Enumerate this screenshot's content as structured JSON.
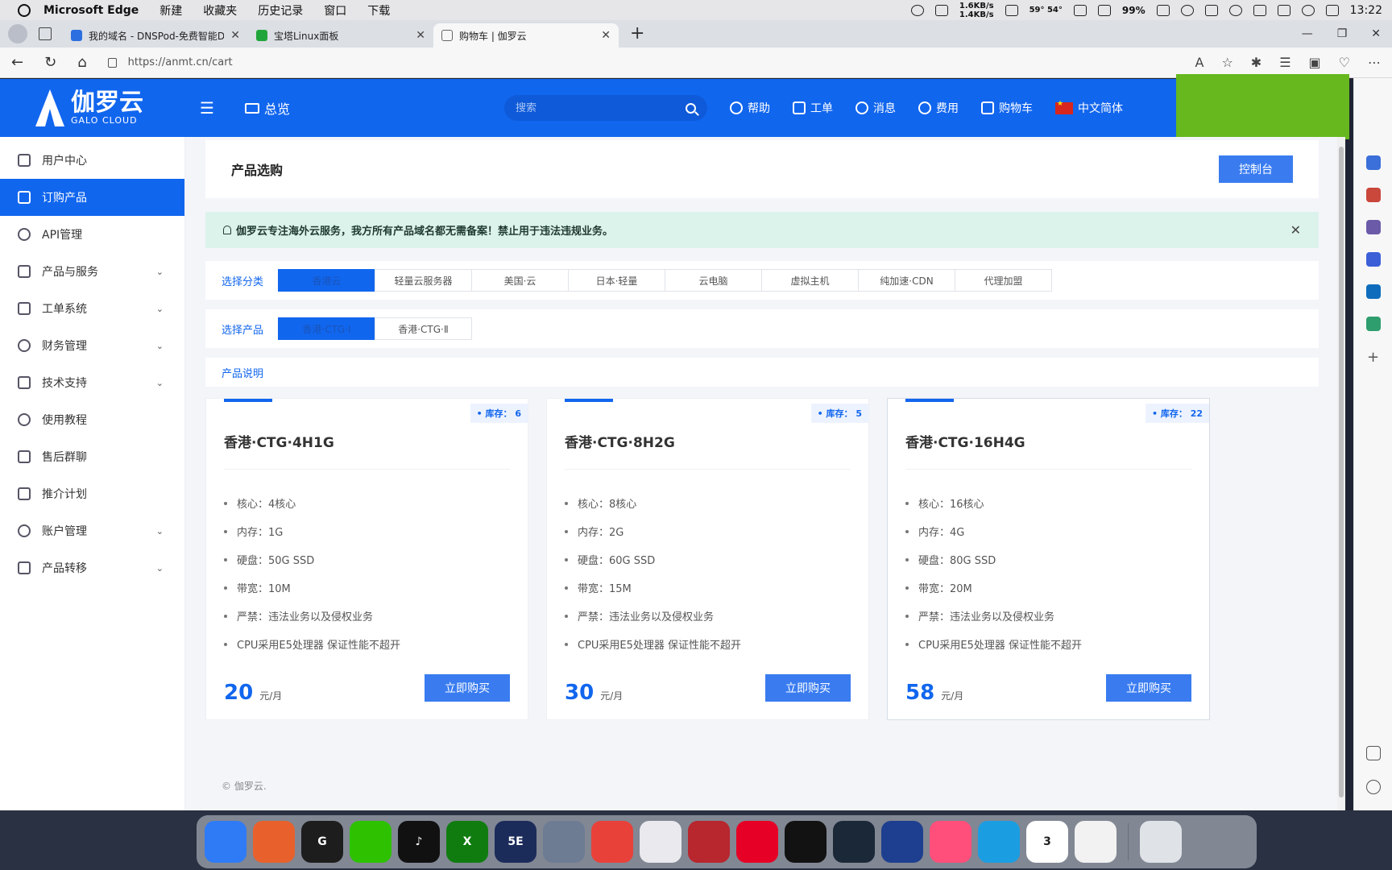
{
  "menubar": {
    "app_name": "Microsoft Edge",
    "menus": [
      "新建",
      "收藏夹",
      "历史记录",
      "窗口",
      "下载"
    ],
    "net_up": "1.6KB/s",
    "net_down": "1.4KB/s",
    "temps": "59° 54°",
    "battery": "99%",
    "time": "13:22"
  },
  "browser": {
    "tabs": [
      {
        "title": "我的域名 - DNSPod-免费智能DN",
        "color": "#2b6fe0"
      },
      {
        "title": "宝塔Linux面板",
        "color": "#20a53a"
      },
      {
        "title": "购物车 | 伽罗云",
        "color": "#bbbbbb"
      }
    ],
    "url": "https://anmt.cn/cart"
  },
  "header": {
    "logo_cn": "伽罗云",
    "logo_en": "GALO CLOUD",
    "overview": "总览",
    "search_placeholder": "搜索",
    "links": [
      {
        "icon": "help-icon",
        "label": "帮助"
      },
      {
        "icon": "ticket-icon",
        "label": "工单"
      },
      {
        "icon": "bell-icon",
        "label": "消息"
      },
      {
        "icon": "coin-icon",
        "label": "费用"
      },
      {
        "icon": "cart-icon",
        "label": "购物车"
      }
    ],
    "language": "中文简体"
  },
  "sidebar": {
    "items": [
      {
        "label": "用户中心",
        "icon": "home-icon",
        "expandable": false
      },
      {
        "label": "订购产品",
        "icon": "cart-icon",
        "expandable": false
      },
      {
        "label": "API管理",
        "icon": "fingerprint-icon",
        "expandable": false
      },
      {
        "label": "产品与服务",
        "icon": "grid-icon",
        "expandable": true
      },
      {
        "label": "工单系统",
        "icon": "chat-icon",
        "expandable": true
      },
      {
        "label": "财务管理",
        "icon": "dollar-icon",
        "expandable": true
      },
      {
        "label": "技术支持",
        "icon": "document-icon",
        "expandable": true
      },
      {
        "label": "使用教程",
        "icon": "search-icon",
        "expandable": false
      },
      {
        "label": "售后群聊",
        "icon": "phone-icon",
        "expandable": false
      },
      {
        "label": "推介计划",
        "icon": "send-icon",
        "expandable": false
      },
      {
        "label": "账户管理",
        "icon": "user-icon",
        "expandable": true
      },
      {
        "label": "产品转移",
        "icon": "grid-icon",
        "expandable": true
      }
    ]
  },
  "page": {
    "title": "产品选购",
    "console_button": "控制台",
    "notice": "伽罗云专注海外云服务，我方所有产品域名都无需备案！禁止用于违法违规业务。",
    "category_label": "选择分类",
    "categories": [
      "香港云",
      "轻量云服务器",
      "美国·云",
      "日本·轻量",
      "云电脑",
      "虚拟主机",
      "纯加速·CDN",
      "代理加盟"
    ],
    "product_label": "选择产品",
    "products": [
      "香港·CTG·I",
      "香港·CTG·Ⅱ"
    ],
    "description_label": "产品说明",
    "stock_label": "库存：",
    "currency_unit": "元/月",
    "buy_button": "立即购买",
    "footer": "© 伽罗云."
  },
  "cards": [
    {
      "name": "香港·CTG·4H1G",
      "stock": "6",
      "price": "20",
      "specs": [
        "核心：4核心",
        "内存：1G",
        "硬盘：50G SSD",
        "带宽：10M",
        "严禁：违法业务以及侵权业务",
        "CPU采用E5处理器 保证性能不超开"
      ]
    },
    {
      "name": "香港·CTG·8H2G",
      "stock": "5",
      "price": "30",
      "specs": [
        "核心：8核心",
        "内存：2G",
        "硬盘：60G SSD",
        "带宽：15M",
        "严禁：违法业务以及侵权业务",
        "CPU采用E5处理器 保证性能不超开"
      ]
    },
    {
      "name": "香港·CTG·16H4G",
      "stock": "22",
      "price": "58",
      "specs": [
        "核心：16核心",
        "内存：4G",
        "硬盘：80G SSD",
        "带宽：20M",
        "严禁：违法业务以及侵权业务",
        "CPU采用E5处理器 保证性能不超开"
      ]
    }
  ],
  "dock": {
    "apps": [
      {
        "name": "finder-icon",
        "color": "#2f7bf5",
        "text": ""
      },
      {
        "name": "firefox-icon",
        "color": "#e8612c",
        "text": ""
      },
      {
        "name": "app-icon",
        "color": "#1d1d1d",
        "text": "G"
      },
      {
        "name": "wechat-icon",
        "color": "#2dc100",
        "text": ""
      },
      {
        "name": "tiktok-icon",
        "color": "#111111",
        "text": "♪"
      },
      {
        "name": "xbox-icon",
        "color": "#107c10",
        "text": "X"
      },
      {
        "name": "5e-icon",
        "color": "#1b2b5a",
        "text": "5E"
      },
      {
        "name": "remote-desktop-icon",
        "color": "#6d7c93",
        "text": ""
      },
      {
        "name": "app-icon",
        "color": "#e8413a",
        "text": ""
      },
      {
        "name": "avatar-icon",
        "color": "#e9e9ee",
        "text": ""
      },
      {
        "name": "avatar-icon",
        "color": "#b8262e",
        "text": ""
      },
      {
        "name": "netease-music-icon",
        "color": "#e60026",
        "text": ""
      },
      {
        "name": "app-icon",
        "color": "#121212",
        "text": ""
      },
      {
        "name": "steam-icon",
        "color": "#1b2838",
        "text": ""
      },
      {
        "name": "rocket-icon",
        "color": "#1e3f8f",
        "text": ""
      },
      {
        "name": "player-icon",
        "color": "#ff4f7a",
        "text": ""
      },
      {
        "name": "edge-icon",
        "color": "#1b9de2",
        "text": ""
      },
      {
        "name": "calendar-icon",
        "color": "#ffffff",
        "text": "3"
      },
      {
        "name": "clock-icon",
        "color": "#f2f2f2",
        "text": ""
      },
      {
        "name": "trash-icon",
        "color": "#dfe3e8",
        "text": ""
      }
    ]
  }
}
